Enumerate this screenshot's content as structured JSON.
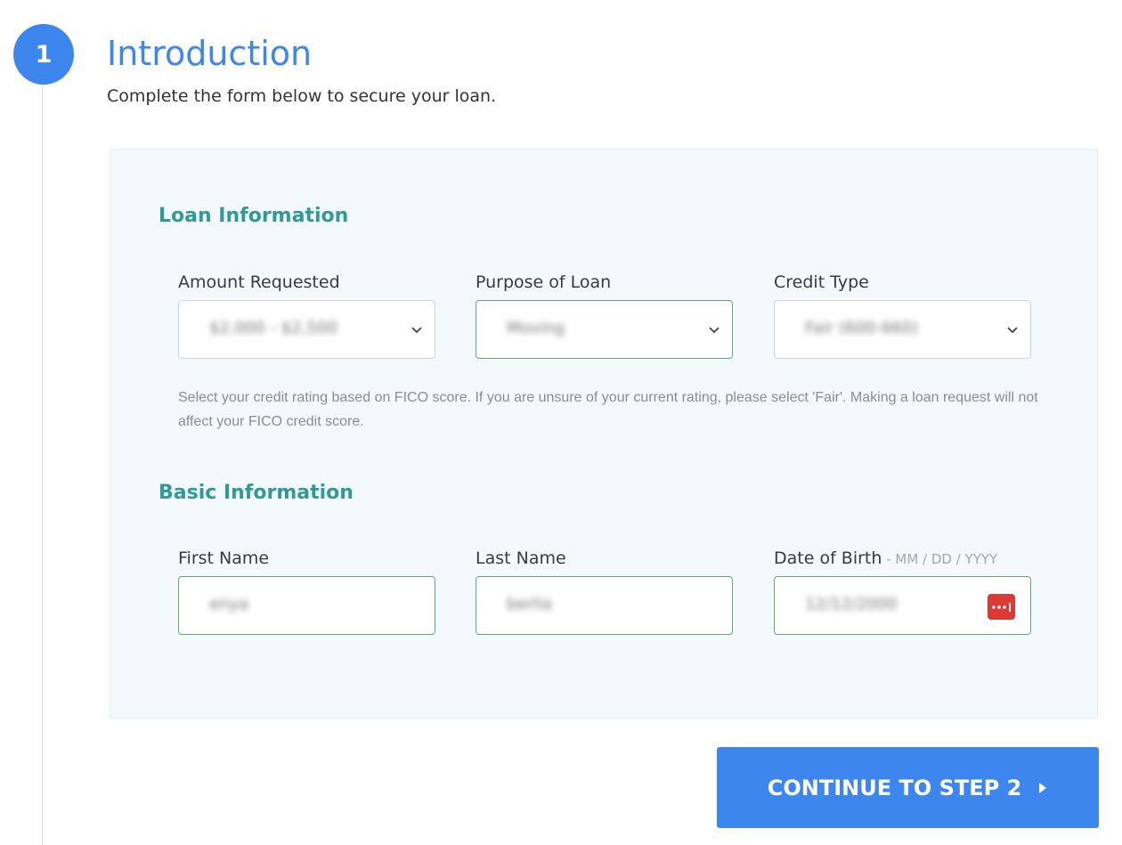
{
  "step": {
    "number": "1",
    "title": "Introduction",
    "subtitle": "Complete the form below to secure your loan."
  },
  "loan_info": {
    "heading": "Loan Information",
    "amount": {
      "label": "Amount Requested",
      "value": "$2,000 - $2,500"
    },
    "purpose": {
      "label": "Purpose of Loan",
      "value": "Moving"
    },
    "credit": {
      "label": "Credit Type",
      "value": "Fair (600-660)"
    },
    "help_text": "Select your credit rating based on FICO score. If you are unsure of your current rating, please select 'Fair'. Making a loan request will not affect your FICO credit score."
  },
  "basic_info": {
    "heading": "Basic Information",
    "first_name": {
      "label": "First Name",
      "value": "enya"
    },
    "last_name": {
      "label": "Last Name",
      "value": "berlia"
    },
    "dob": {
      "label": "Date of Birth",
      "hint": " - MM / DD / YYYY",
      "value": "12/12/2000"
    }
  },
  "continue_button": {
    "label": "CONTINUE TO STEP 2"
  },
  "icons": {
    "select": "chevron-down-icon",
    "password_manager": "password-manager-icon",
    "continue": "caret-right-icon"
  },
  "colors": {
    "accent_blue": "#3d86ee",
    "heading_teal": "#2f9a96",
    "panel_bg": "#f4f9fd",
    "valid_border": "#66a86b",
    "password_icon_red": "#dc3b35"
  }
}
